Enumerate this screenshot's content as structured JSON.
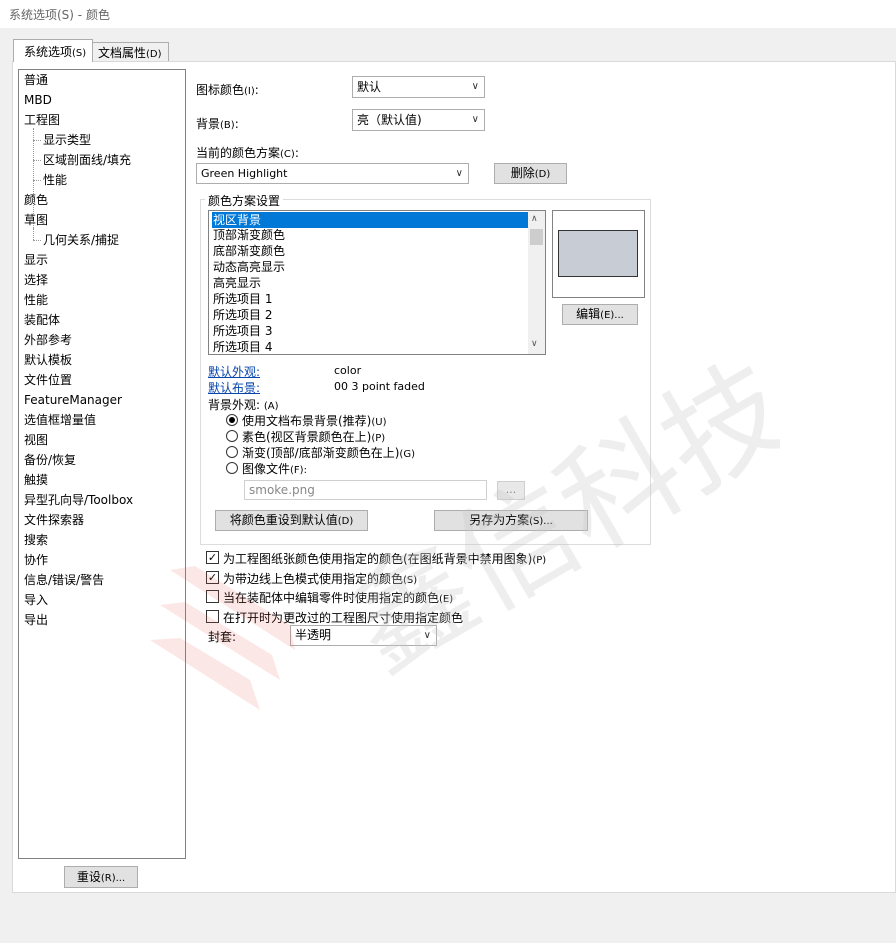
{
  "window": {
    "title": "系统选项(S) - 颜色"
  },
  "tabs": [
    {
      "label": "系统选项",
      "mnemonic": "(S)"
    },
    {
      "label": "文档属性",
      "mnemonic": "(D)"
    }
  ],
  "nav": {
    "items": [
      {
        "label": "普通"
      },
      {
        "label": "MBD"
      },
      {
        "label": "工程图"
      },
      {
        "label": "显示类型"
      },
      {
        "label": "区域剖面线/填充"
      },
      {
        "label": "性能"
      },
      {
        "label": "颜色"
      },
      {
        "label": "草图"
      },
      {
        "label": "几何关系/捕捉"
      },
      {
        "label": "显示"
      },
      {
        "label": "选择"
      },
      {
        "label": "性能"
      },
      {
        "label": "装配体"
      },
      {
        "label": "外部参考"
      },
      {
        "label": "默认模板"
      },
      {
        "label": "文件位置"
      },
      {
        "label": "FeatureManager"
      },
      {
        "label": "选值框增量值"
      },
      {
        "label": "视图"
      },
      {
        "label": "备份/恢复"
      },
      {
        "label": "触摸"
      },
      {
        "label": "异型孔向导/Toolbox"
      },
      {
        "label": "文件探索器"
      },
      {
        "label": "搜索"
      },
      {
        "label": "协作"
      },
      {
        "label": "信息/错误/警告"
      },
      {
        "label": "导入"
      },
      {
        "label": "导出"
      }
    ],
    "reset_label": "重设",
    "reset_mnemonic": "(R)..."
  },
  "icon_color": {
    "label": "图标颜色",
    "mnemonic": "(I)",
    "suffix": ":",
    "value": "默认"
  },
  "background": {
    "label": "背景",
    "mnemonic": "(B)",
    "suffix": ":",
    "value": "亮（默认值)"
  },
  "scheme": {
    "label": "当前的颜色方案",
    "mnemonic": "(C)",
    "suffix": ":",
    "value": "Green Highlight",
    "delete_label": "删除",
    "delete_mnemonic": "(D)"
  },
  "scheme_settings": {
    "title": "颜色方案设置",
    "items": [
      {
        "label": "视区背景"
      },
      {
        "label": "顶部渐变颜色"
      },
      {
        "label": "底部渐变颜色"
      },
      {
        "label": "动态高亮显示"
      },
      {
        "label": "高亮显示"
      },
      {
        "label": "所选项目 1"
      },
      {
        "label": "所选项目 2"
      },
      {
        "label": "所选项目 3"
      },
      {
        "label": "所选项目 4"
      }
    ],
    "swatch_color": "#c8ccd4",
    "edit_label": "编辑",
    "edit_mnemonic": "(E)...",
    "default_appearance_label": "默认外观:",
    "default_appearance_value": "color",
    "default_scene_label": "默认布景:",
    "default_scene_value": "00 3 point faded",
    "bg_appearance_label": "背景外观:",
    "bg_appearance_mnemonic": "(A)",
    "radios": [
      {
        "label": "使用文档布景背景(推荐)",
        "mnemonic": "(U)",
        "checked": true
      },
      {
        "label": "素色(视区背景颜色在上)",
        "mnemonic": "(P)",
        "checked": false
      },
      {
        "label": "渐变(顶部/底部渐变颜色在上)",
        "mnemonic": "(G)",
        "checked": false
      },
      {
        "label": "图像文件",
        "mnemonic": "(F):",
        "checked": false
      }
    ],
    "image_file_value": "smoke.png",
    "browse_label": "...",
    "reset_colors_label": "将颜色重设到默认值",
    "reset_colors_mnemonic": "(D)",
    "save_as_label": "另存为方案",
    "save_as_mnemonic": "(S)..."
  },
  "checkboxes": [
    {
      "label": "为工程图纸张颜色使用指定的颜色(在图纸背景中禁用图象)",
      "mnemonic": "(P)",
      "checked": true
    },
    {
      "label": "为带边线上色模式使用指定的颜色",
      "mnemonic": "(S)",
      "checked": true
    },
    {
      "label": "当在装配体中编辑零件时使用指定的颜色",
      "mnemonic": "(E)",
      "checked": false
    },
    {
      "label": "在打开时为更改过的工程图尺寸使用指定颜色",
      "mnemonic": "",
      "checked": false
    }
  ],
  "envelope": {
    "label": "封套:",
    "value": "半透明"
  },
  "watermark": {
    "text": "鑫信科技",
    "color": "#e84c3d"
  },
  "colors": {
    "selection": "#0078d7",
    "link": "#0645ad"
  }
}
